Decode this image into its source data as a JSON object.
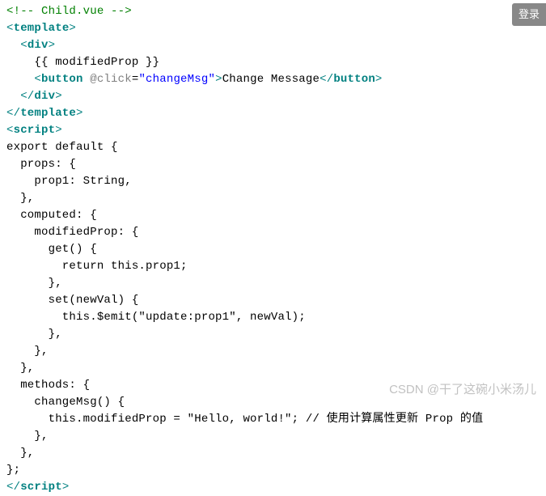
{
  "login_button": "登录",
  "watermark": "CSDN @干了这碗小米汤儿",
  "code": {
    "line1_comment": "<!-- Child.vue -->",
    "tag_template": "template",
    "tag_div": "div",
    "tag_button": "button",
    "tag_script": "script",
    "interpolation": "    {{ modifiedProp }}",
    "attr_click": "@click",
    "attr_click_val": "\"changeMsg\"",
    "button_text": "Change Message",
    "script_body_l1": "export default {",
    "script_body_l2": "  props: {",
    "script_body_l3": "    prop1: String,",
    "script_body_l4": "  },",
    "script_body_l5": "  computed: {",
    "script_body_l6": "    modifiedProp: {",
    "script_body_l7": "      get() {",
    "script_body_l8": "        return this.prop1;",
    "script_body_l9": "      },",
    "script_body_l10": "      set(newVal) {",
    "script_body_l11": "        this.$emit(\"update:prop1\", newVal);",
    "script_body_l12": "      },",
    "script_body_l13": "    },",
    "script_body_l14": "  },",
    "script_body_l15": "  methods: {",
    "script_body_l16": "    changeMsg() {",
    "script_body_l17": "      this.modifiedProp = \"Hello, world!\"; // 使用计算属性更新 Prop 的值",
    "script_body_l18": "    },",
    "script_body_l19": "  },",
    "script_body_l20": "};"
  }
}
